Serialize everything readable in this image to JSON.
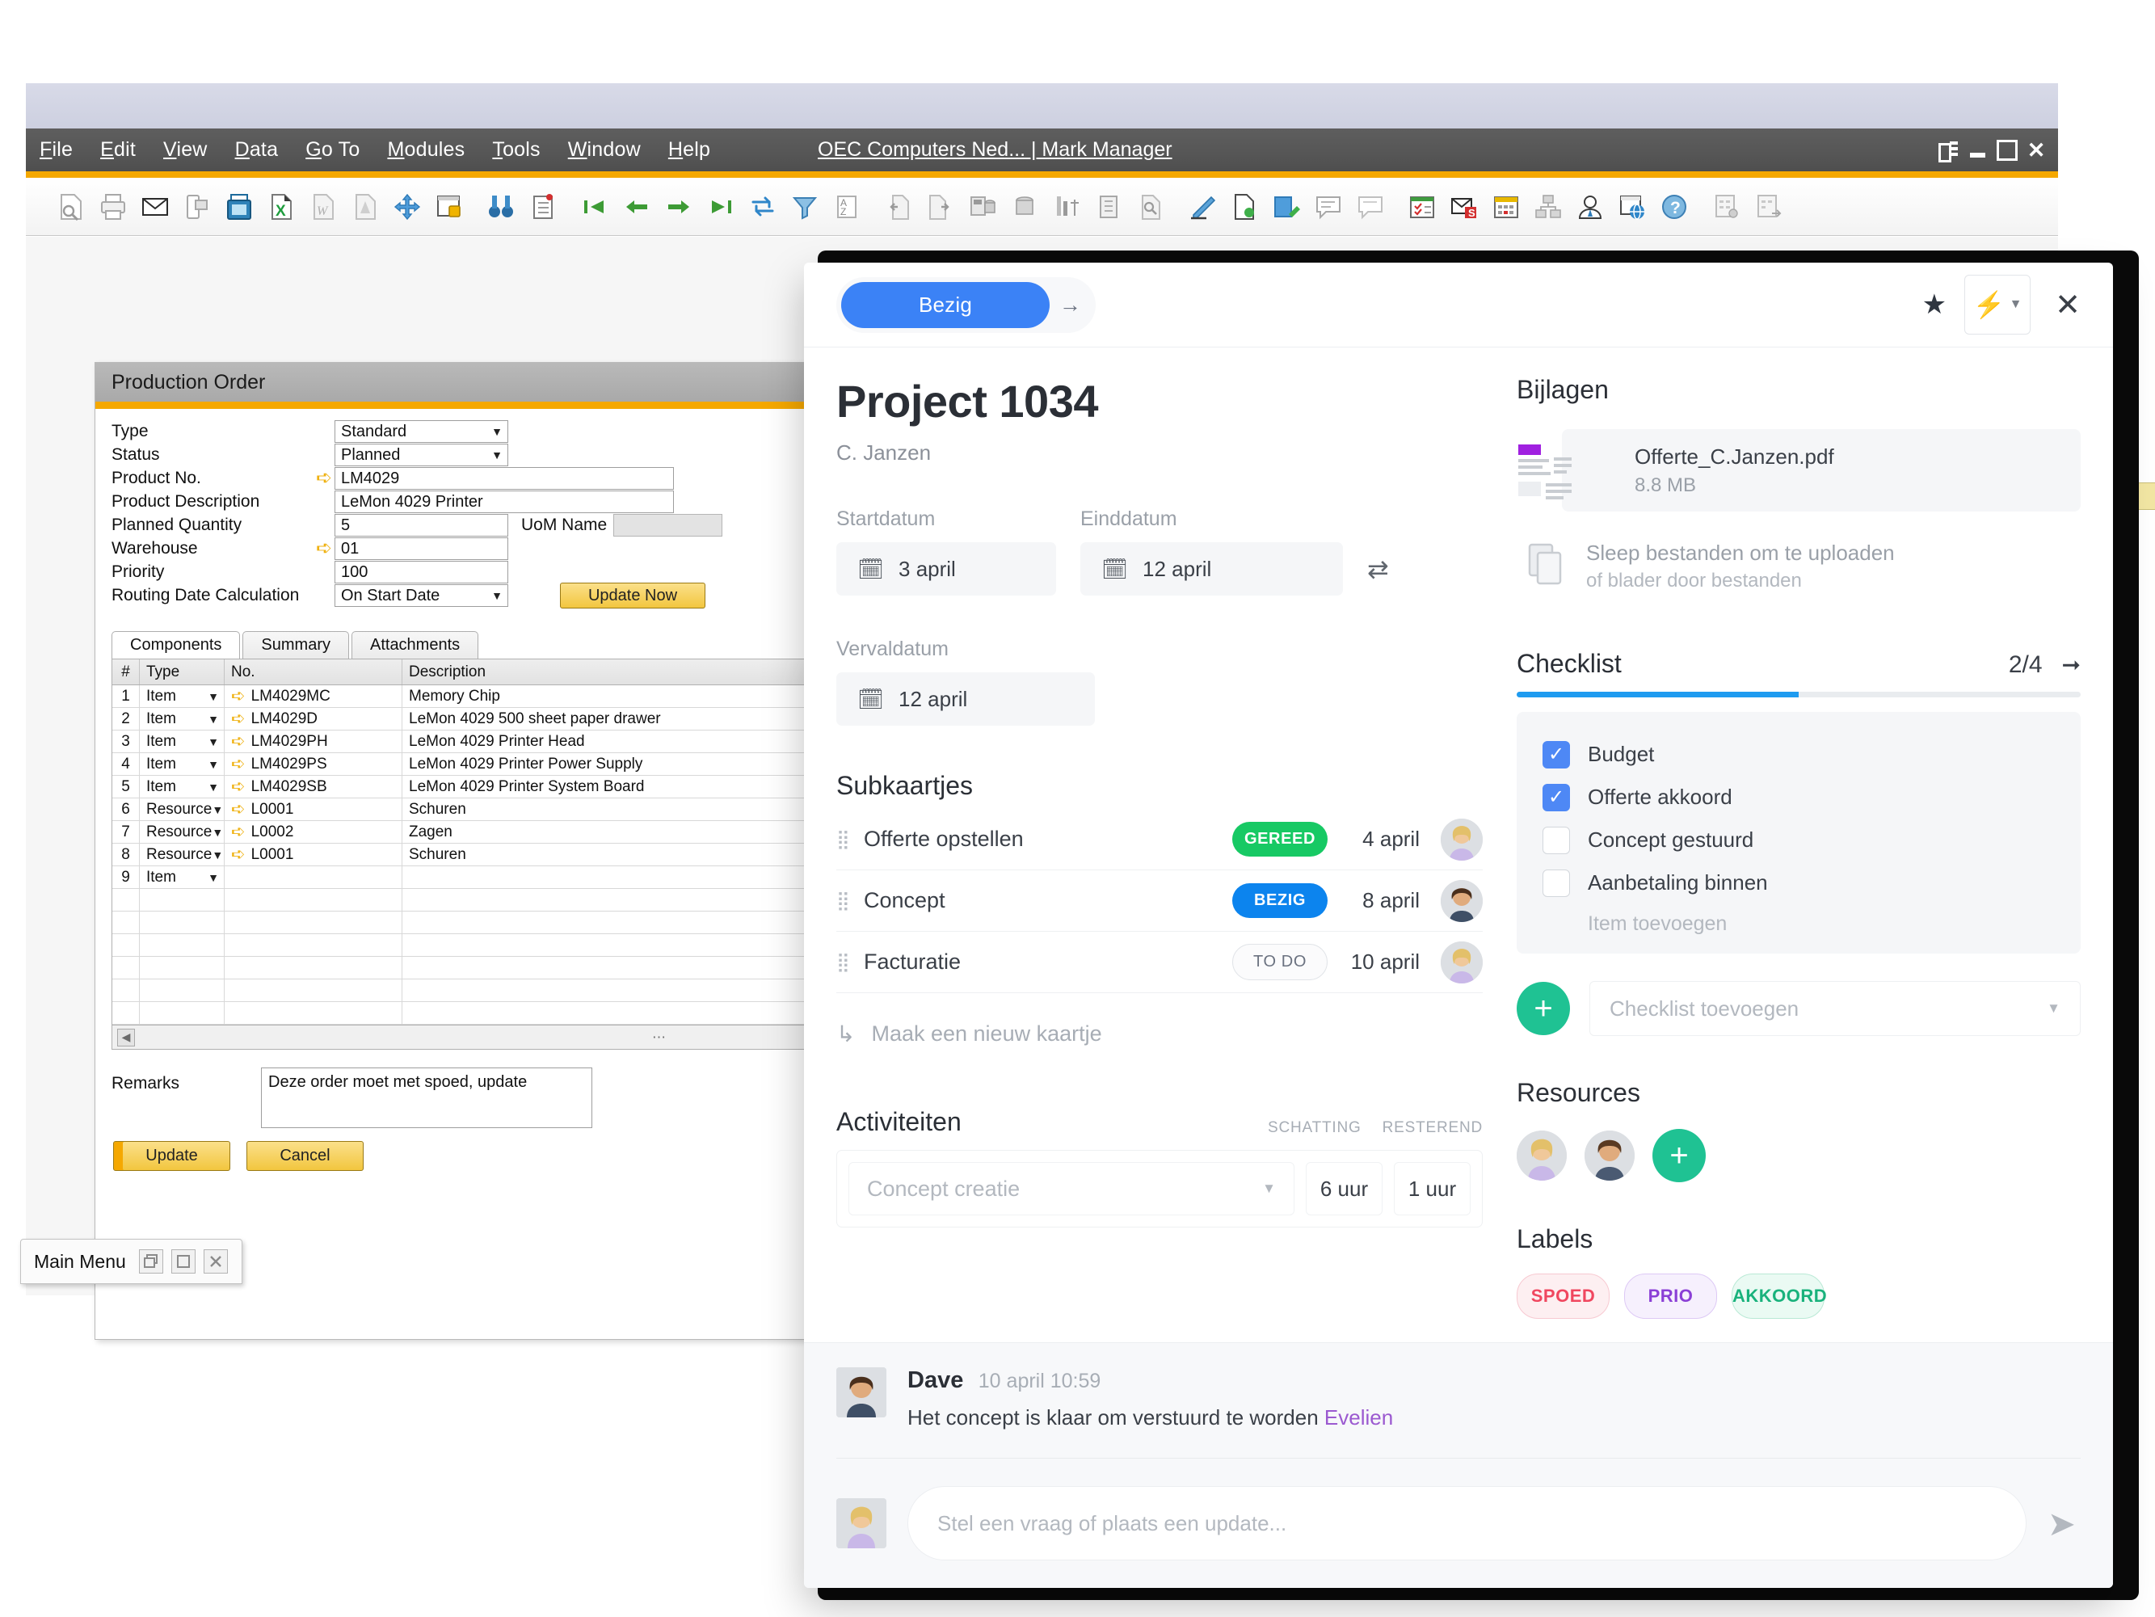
{
  "sap": {
    "window_title": "OEC Computers Ned... | Mark Manager",
    "menu": [
      "File",
      "Edit",
      "View",
      "Data",
      "Go To",
      "Modules",
      "Tools",
      "Window",
      "Help"
    ],
    "form_title": "Production Order",
    "fields": [
      {
        "label": "Type",
        "value": "Standard",
        "kind": "select",
        "arrow": false
      },
      {
        "label": "Status",
        "value": "Planned",
        "kind": "select",
        "arrow": false
      },
      {
        "label": "Product No.",
        "value": "LM4029",
        "kind": "wide",
        "arrow": true
      },
      {
        "label": "Product Description",
        "value": "LeMon 4029 Printer",
        "kind": "wide",
        "arrow": false
      },
      {
        "label": "Planned Quantity",
        "value": "5",
        "kind": "mid",
        "arrow": false
      },
      {
        "label": "Warehouse",
        "value": "01",
        "kind": "mid",
        "arrow": true
      },
      {
        "label": "Priority",
        "value": "100",
        "kind": "mid",
        "arrow": false
      },
      {
        "label": "Routing Date Calculation",
        "value": "On Start Date",
        "kind": "select",
        "arrow": false
      }
    ],
    "uom_label": "UoM Name",
    "uom_value": "",
    "update_now_label": "Update Now",
    "tabs": [
      "Components",
      "Summary",
      "Attachments"
    ],
    "grid_headers": [
      "#",
      "Type",
      "No.",
      "Description"
    ],
    "grid_rows": [
      {
        "n": "1",
        "type": "Item",
        "no": "LM4029MC",
        "desc": "Memory Chip"
      },
      {
        "n": "2",
        "type": "Item",
        "no": "LM4029D",
        "desc": "LeMon 4029 500 sheet paper drawer"
      },
      {
        "n": "3",
        "type": "Item",
        "no": "LM4029PH",
        "desc": "LeMon 4029 Printer Head"
      },
      {
        "n": "4",
        "type": "Item",
        "no": "LM4029PS",
        "desc": "LeMon 4029 Printer Power Supply"
      },
      {
        "n": "5",
        "type": "Item",
        "no": "LM4029SB",
        "desc": "LeMon 4029 Printer System Board"
      },
      {
        "n": "6",
        "type": "Resource",
        "no": "L0001",
        "desc": "Schuren"
      },
      {
        "n": "7",
        "type": "Resource",
        "no": "L0002",
        "desc": "Zagen"
      },
      {
        "n": "8",
        "type": "Resource",
        "no": "L0001",
        "desc": "Schuren"
      },
      {
        "n": "9",
        "type": "Item",
        "no": "",
        "desc": ""
      },
      {
        "n": "",
        "type": "",
        "no": "",
        "desc": ""
      },
      {
        "n": "",
        "type": "",
        "no": "",
        "desc": ""
      },
      {
        "n": "",
        "type": "",
        "no": "",
        "desc": ""
      },
      {
        "n": "",
        "type": "",
        "no": "",
        "desc": ""
      },
      {
        "n": "",
        "type": "",
        "no": "",
        "desc": ""
      },
      {
        "n": "",
        "type": "",
        "no": "",
        "desc": ""
      }
    ],
    "remarks_label": "Remarks",
    "remarks_value": "Deze order moet met spoed, update",
    "update_label": "Update",
    "cancel_label": "Cancel",
    "main_menu_label": "Main Menu"
  },
  "modal": {
    "status_label": "Bezig",
    "status_color": "#3b82f6",
    "next_arrow": "→",
    "title": "Project 1034",
    "subtitle": "C. Janzen",
    "dates": {
      "start_label": "Startdatum",
      "start_value": "3 april",
      "end_label": "Einddatum",
      "end_value": "12 april",
      "due_label": "Vervaldatum",
      "due_value": "12 april"
    },
    "subcards": {
      "title": "Subkaartjes",
      "items": [
        {
          "name": "Offerte opstellen",
          "status": "GEREED",
          "status_kind": "gereed",
          "date": "4 april"
        },
        {
          "name": "Concept",
          "status": "BEZIG",
          "status_kind": "bezig",
          "date": "8 april"
        },
        {
          "name": "Facturatie",
          "status": "TO DO",
          "status_kind": "todo",
          "date": "10 april"
        }
      ],
      "new_card_label": "Maak een nieuw kaartje"
    },
    "activities": {
      "title": "Activiteiten",
      "col_estimate": "SCHATTING",
      "col_remaining": "RESTEREND",
      "selected": "Concept creatie",
      "estimate": "6 uur",
      "remaining": "1 uur"
    },
    "attachments": {
      "title": "Bijlagen",
      "file_name": "Offerte_C.Janzen.pdf",
      "file_size": "8.8 MB",
      "drop_line1": "Sleep bestanden om te uploaden",
      "drop_line2": "of blader door bestanden"
    },
    "checklist": {
      "title": "Checklist",
      "count": "2/4",
      "progress_pct": 50,
      "items": [
        {
          "label": "Budget",
          "checked": true
        },
        {
          "label": "Offerte akkoord",
          "checked": true
        },
        {
          "label": "Concept gestuurd",
          "checked": false
        },
        {
          "label": "Aanbetaling binnen",
          "checked": false
        }
      ],
      "add_item_label": "Item toevoegen",
      "add_checklist_placeholder": "Checklist toevoegen"
    },
    "resources": {
      "title": "Resources"
    },
    "labels": {
      "title": "Labels",
      "chips": [
        {
          "text": "SPOED",
          "kind": "spoed"
        },
        {
          "text": "PRIO",
          "kind": "prio"
        },
        {
          "text": "AKKOORD",
          "kind": "akkoord"
        }
      ]
    },
    "comment": {
      "author": "Dave",
      "time": "10 april 10:59",
      "text": "Het concept is klaar om verstuurd te worden ",
      "mention": "Evelien",
      "input_placeholder": "Stel een vraag of plaats een update..."
    }
  }
}
